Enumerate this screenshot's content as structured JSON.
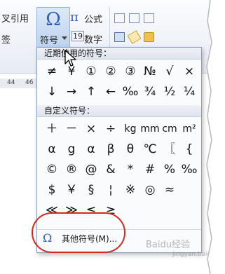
{
  "ribbon": {
    "cross_ref_label": "叉引用",
    "sign_label": "签",
    "symbol_button_label": "符号",
    "formula_label": "公式",
    "number_label": "数字",
    "ruler_nums": [
      "44",
      "46"
    ]
  },
  "symbol_menu": {
    "recent_header": "近期使用的符号：",
    "recent_symbols": [
      "≠",
      "¥",
      "①",
      "②",
      "③",
      "№",
      "√",
      "×",
      "↓",
      "→",
      "↑",
      "←",
      "‰",
      "¾",
      "½",
      "¼"
    ],
    "custom_header": "自定义符号：",
    "custom_symbols": [
      "＋",
      "－",
      "×",
      "÷",
      "kg",
      "mm",
      "cm",
      "m²",
      "α",
      "g",
      "α",
      "β",
      "θ",
      "℃",
      "〖",
      "{",
      "©",
      "®",
      "@",
      "&",
      "*",
      "#",
      "%",
      "‰",
      "$",
      "￥",
      "§",
      "¦",
      "※",
      "◎",
      "≈",
      "",
      "≪",
      "≫",
      "≤",
      "≥",
      "",
      "",
      "",
      ""
    ],
    "more_symbols_label": "其他符号(M)..."
  },
  "watermark": {
    "text": "Baidu经验",
    "sub": "jingyan.baidu.com"
  },
  "colors": {
    "accent": "#2d5fb5",
    "highlight": "#d9261c"
  }
}
